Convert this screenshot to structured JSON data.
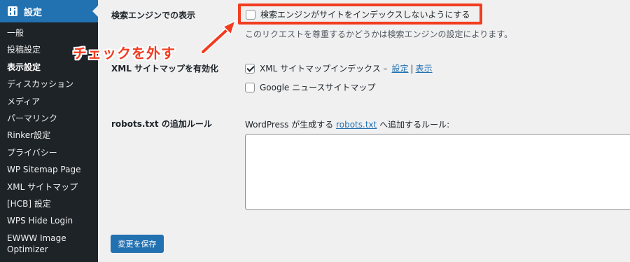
{
  "sidebar": {
    "header": {
      "label": "設定",
      "icon": "settings-sliders-icon"
    },
    "items": [
      {
        "label": "一般",
        "current": false
      },
      {
        "label": "投稿設定",
        "current": false
      },
      {
        "label": "表示設定",
        "current": true
      },
      {
        "label": "ディスカッション",
        "current": false
      },
      {
        "label": "メディア",
        "current": false
      },
      {
        "label": "パーマリンク",
        "current": false
      },
      {
        "label": "Rinker設定",
        "current": false
      },
      {
        "label": "プライバシー",
        "current": false
      },
      {
        "label": "WP Sitemap Page",
        "current": false
      },
      {
        "label": "XML サイトマップ",
        "current": false
      },
      {
        "label": "[HCB] 設定",
        "current": false
      },
      {
        "label": "WPS Hide Login",
        "current": false
      },
      {
        "label": "EWWW Image Optimizer",
        "current": false
      }
    ],
    "bg_color": "#1d2327",
    "header_color": "#2271b1"
  },
  "search_visibility": {
    "label": "検索エンジンでの表示",
    "checkbox_label": "検索エンジンがサイトをインデックスしないようにする",
    "checked": false,
    "description": "このリクエストを尊重するかどうかは検索エンジンの設定によります。"
  },
  "annotation": {
    "callout": "チェックを外す",
    "color": "#f23c20"
  },
  "xml_sitemap": {
    "label": "XML サイトマップを有効化",
    "index_label": "XML サイトマップインデックス –",
    "index_checked": true,
    "settings_link": "設定",
    "separator": "|",
    "view_link": "表示",
    "google_label": "Google ニュースサイトマップ",
    "google_checked": false
  },
  "robots": {
    "label": "robots.txt の追加ルール",
    "desc_prefix": "WordPress が生成する",
    "desc_link": "robots.txt",
    "desc_suffix": "へ追加するルール:",
    "value": ""
  },
  "save_button": {
    "label": "変更を保存"
  },
  "accent_color": "#2271b1"
}
